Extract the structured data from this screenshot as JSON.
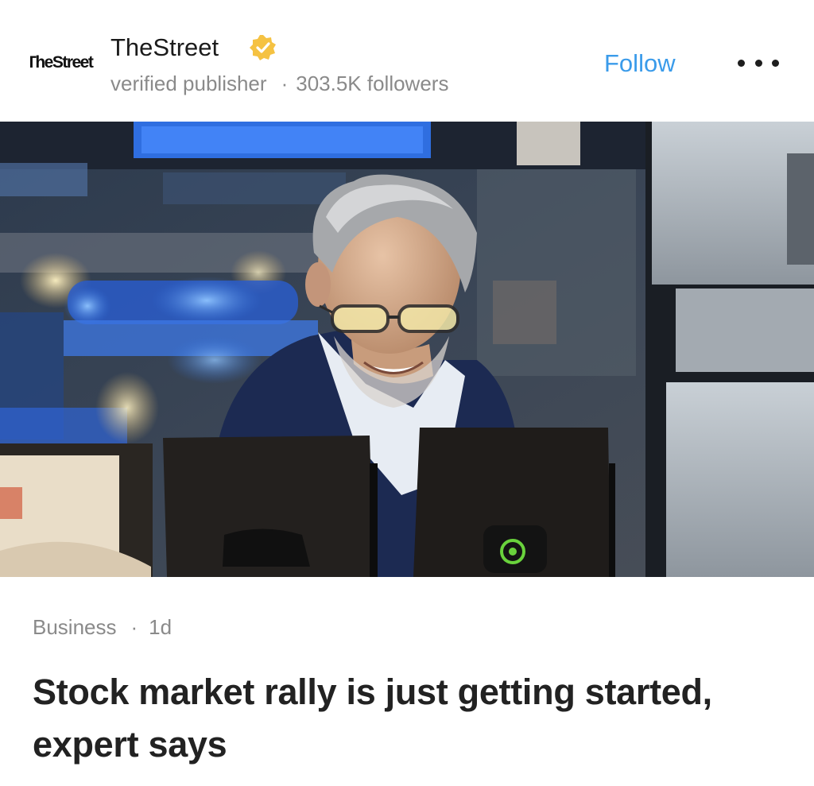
{
  "publisher": {
    "logo_text": "TheStreet",
    "name": "TheStreet",
    "verified_badge_icon": "verified-check-icon",
    "badge_color": "#f5c242",
    "label": "verified publisher",
    "separator": "·",
    "followers": "303.5K followers"
  },
  "actions": {
    "follow_label": "Follow",
    "follow_color": "#3a9bea",
    "more_icon": "more-horizontal-icon"
  },
  "article": {
    "category": "Business",
    "separator": "·",
    "age": "1d",
    "headline": "Stock market rally is just getting started, expert says"
  }
}
